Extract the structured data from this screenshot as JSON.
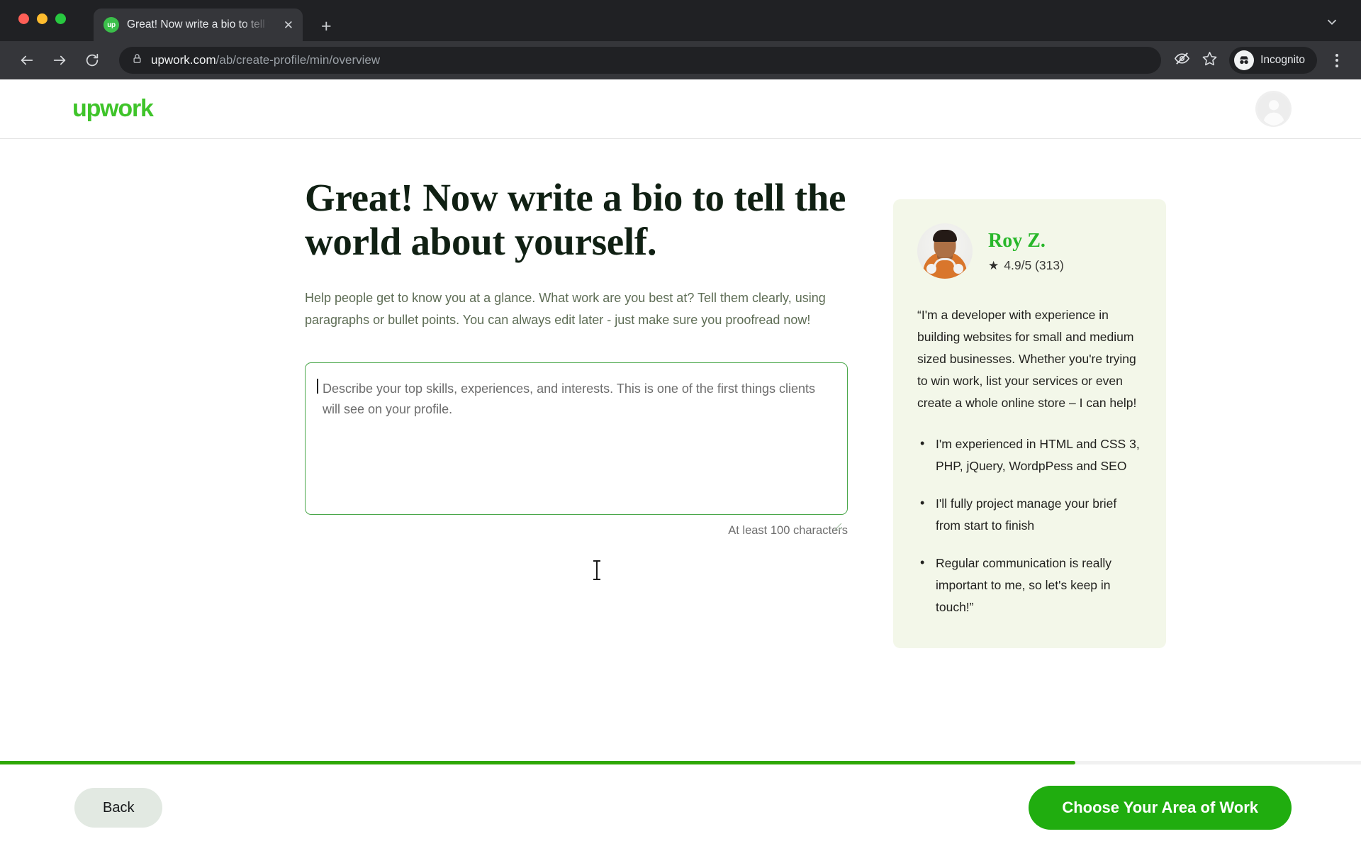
{
  "browser": {
    "tab": {
      "title": "Great! Now write a bio to tell th",
      "favicon_text": "up",
      "close_glyph": "✕"
    },
    "new_tab_glyph": "+",
    "tab_list_glyph": "⌄",
    "nav": {
      "back_glyph": "←",
      "forward_glyph": "→",
      "reload_glyph": "⟳"
    },
    "url": {
      "host": "upwork.com",
      "path": "/ab/create-profile/min/overview",
      "lock_icon": "lock-icon"
    },
    "profile_label": "Incognito",
    "icons": {
      "eye_off": "eye-off-icon",
      "bookmark_star": "star-icon",
      "menu": "kebab-menu-icon"
    }
  },
  "site_header": {
    "logo_text": "upwork",
    "avatar_name": "user-avatar"
  },
  "main": {
    "headline": "Great! Now write a bio to tell the world about yourself.",
    "subtext": "Help people get to know you at a glance. What work are you best at? Tell them clearly, using paragraphs or bullet points. You can always edit later - just make sure you proofread now!",
    "bio_field": {
      "value": "",
      "placeholder": "Describe your top skills, experiences, and interests. This is one of the first things clients will see on your profile."
    },
    "char_hint": "At least 100 characters"
  },
  "testimonial": {
    "name": "Roy Z.",
    "rating_text": "4.9/5 (313)",
    "star_glyph": "★",
    "quote": "“I'm a developer with experience in building websites for small and medium sized businesses. Whether you're trying to win work, list your services or even create a whole online store – I can help!",
    "bullets": [
      "I'm experienced in HTML and CSS 3, PHP, jQuery, WordpPess and SEO",
      "I'll fully project manage your brief from start to finish",
      "Regular communication is really important to me, so let's keep in touch!”"
    ]
  },
  "footer": {
    "progress_percent": 79,
    "back_label": "Back",
    "cta_label": "Choose Your Area of Work"
  },
  "colors": {
    "brand_green": "#3fc42a",
    "cta_green": "#20ad0f",
    "progress_green": "#2fa805",
    "headline_green": "#102013",
    "card_bg": "#f3f7e9",
    "chrome_dark": "#202124"
  }
}
